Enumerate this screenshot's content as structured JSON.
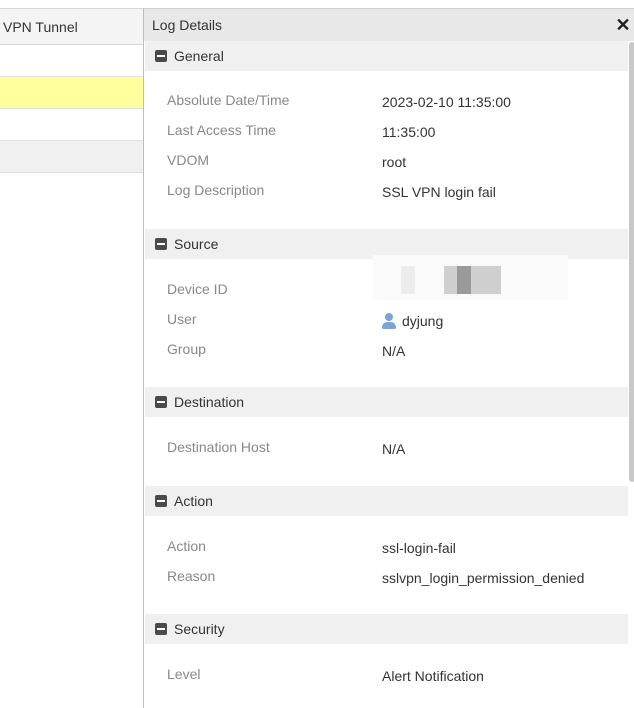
{
  "left_table": {
    "header": "VPN Tunnel"
  },
  "panel": {
    "title": "Log Details",
    "close_icon": "close-icon",
    "sections": {
      "general": {
        "title": "General",
        "fields": [
          {
            "label": "Absolute Date/Time",
            "value": "2023-02-10 11:35:00"
          },
          {
            "label": "Last Access Time",
            "value": "11:35:00"
          },
          {
            "label": "VDOM",
            "value": "root"
          },
          {
            "label": "Log Description",
            "value": "SSL VPN login fail"
          }
        ]
      },
      "source": {
        "title": "Source",
        "fields": [
          {
            "label": "Device ID",
            "value": ""
          },
          {
            "label": "User",
            "value": "dyjung",
            "icon": "user-icon"
          },
          {
            "label": "Group",
            "value": "N/A"
          }
        ]
      },
      "destination": {
        "title": "Destination",
        "fields": [
          {
            "label": "Destination Host",
            "value": "N/A"
          }
        ]
      },
      "action": {
        "title": "Action",
        "fields": [
          {
            "label": "Action",
            "value": "ssl-login-fail"
          },
          {
            "label": "Reason",
            "value": "sslvpn_login_permission_denied"
          }
        ]
      },
      "security": {
        "title": "Security",
        "fields": [
          {
            "label": "Level",
            "value": "Alert Notification"
          }
        ]
      }
    }
  },
  "colors": {
    "highlight_row": "#ffff9e",
    "section_bg": "#f0f0f0",
    "user_icon": "#7ba3d8"
  }
}
